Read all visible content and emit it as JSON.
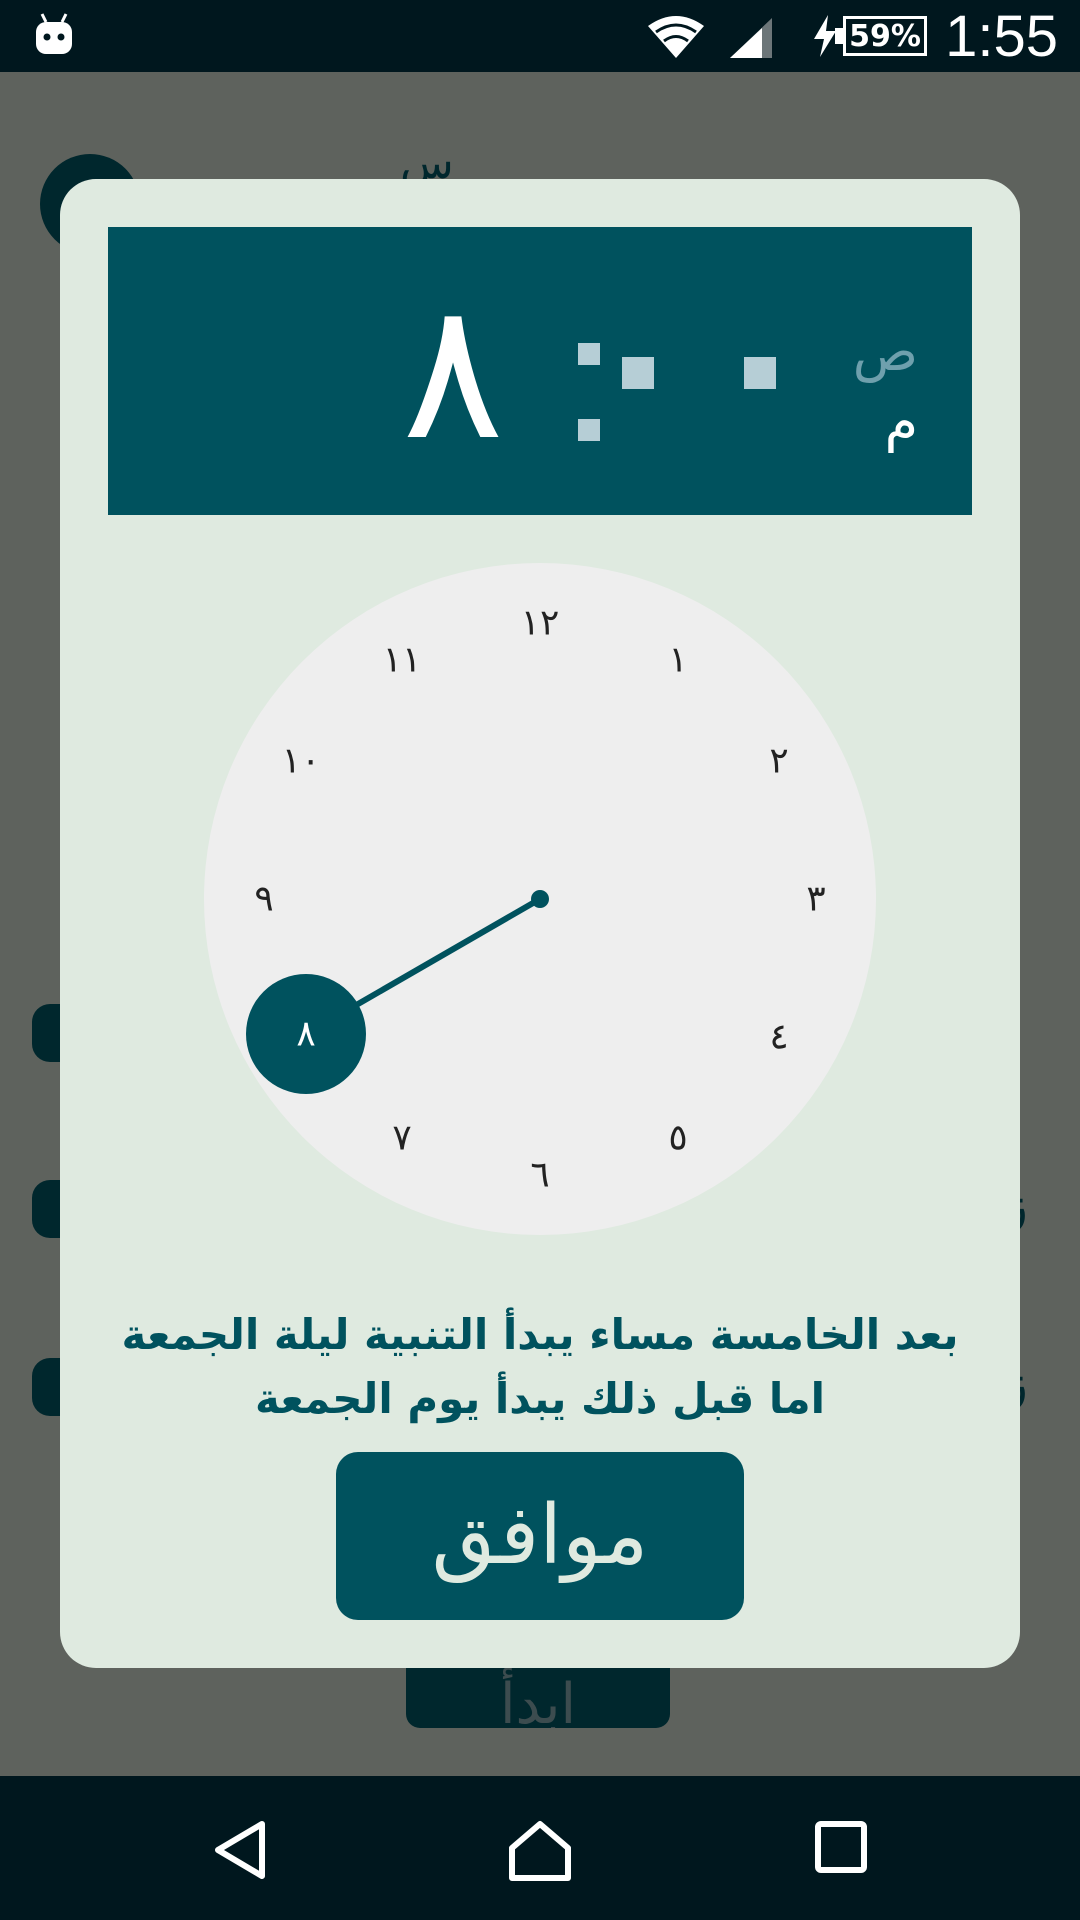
{
  "status_bar": {
    "icons": [
      "android-icon",
      "wifi-icon",
      "signal-icon",
      "charging-bolt-icon",
      "battery-icon"
    ],
    "battery": "59%",
    "time": "1:55"
  },
  "background_page": {
    "title_partial": "س",
    "start_button_partial": "ابدأ",
    "edge_text": [
      "ز",
      "ز"
    ]
  },
  "time_picker": {
    "selected_hour": "٨",
    "am_label": "ص",
    "pm_label": "م",
    "selected_period": "pm",
    "clock_numbers": [
      "١٢",
      "١",
      "٢",
      "٣",
      "٤",
      "٥",
      "٦",
      "٧",
      "٨",
      "٩",
      "١٠",
      "١١"
    ],
    "hint_line_1": "بعد الخامسة مساء يبدأ التنبية ليلة الجمعة",
    "hint_line_2": "اما قبل ذلك يبدأ يوم الجمعة",
    "ok_label": "موافق"
  },
  "colors": {
    "accent": "#00525e",
    "dialog_bg": "#dfeae0",
    "clock_face": "#eeeeee",
    "system_bar": "#00171e"
  },
  "nav_bar": {
    "icons": [
      "back-icon",
      "home-icon",
      "recents-icon"
    ]
  }
}
